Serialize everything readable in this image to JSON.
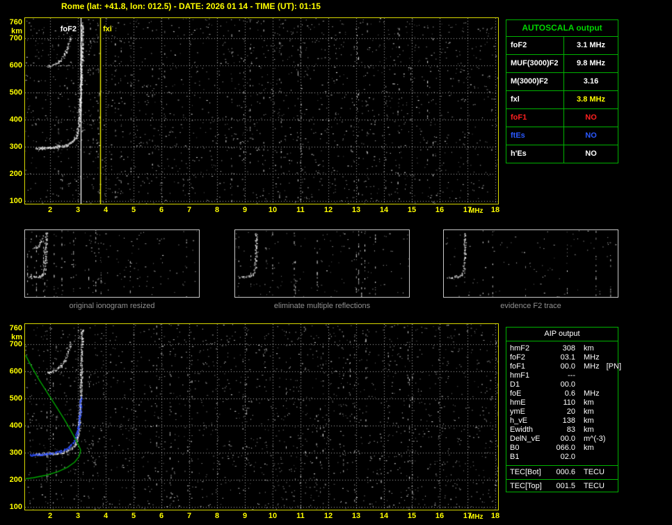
{
  "header": {
    "title": "Rome (lat: +41.8, lon: 012.5) - DATE: 2026 01 14 - TIME (UT): 01:15"
  },
  "autoscala": {
    "header": "AUTOSCALA output",
    "rows": [
      {
        "label": "foF2",
        "value": "3.1 MHz",
        "label_color": "#ffffff",
        "value_color": "#ffffff"
      },
      {
        "label": "MUF(3000)F2",
        "value": "9.8 MHz",
        "label_color": "#ffffff",
        "value_color": "#ffffff"
      },
      {
        "label": "M(3000)F2",
        "value": "3.16",
        "label_color": "#ffffff",
        "value_color": "#ffffff"
      },
      {
        "label": "fxl",
        "value": "3.8 MHz",
        "label_color": "#ffffff",
        "value_color": "#ffff00"
      },
      {
        "label": "foF1",
        "value": "NO",
        "label_color": "#ff2020",
        "value_color": "#ff2020"
      },
      {
        "label": "ftEs",
        "value": "NO",
        "label_color": "#2a58ff",
        "value_color": "#2a58ff"
      },
      {
        "label": "h'Es",
        "value": "NO",
        "label_color": "#ffffff",
        "value_color": "#ffffff"
      }
    ]
  },
  "thumbnails": [
    {
      "caption": "original ionogram resized"
    },
    {
      "caption": "eliminate multiple reflections"
    },
    {
      "caption": "evidence F2 trace"
    }
  ],
  "aip": {
    "header": "AIP output",
    "rows": [
      {
        "name": "hmF2",
        "value": "308",
        "unit": "km",
        "note": ""
      },
      {
        "name": "foF2",
        "value": "03.1",
        "unit": "MHz",
        "note": ""
      },
      {
        "name": "foF1",
        "value": "00.0",
        "unit": "MHz",
        "note": "[PN]"
      },
      {
        "name": "hmF1",
        "value": "---",
        "unit": "",
        "note": ""
      },
      {
        "name": "D1",
        "value": "00.0",
        "unit": "",
        "note": ""
      },
      {
        "name": "foE",
        "value": "0.6",
        "unit": "MHz",
        "note": ""
      },
      {
        "name": "hmE",
        "value": "110",
        "unit": "km",
        "note": ""
      },
      {
        "name": "ymE",
        "value": "20",
        "unit": "km",
        "note": ""
      },
      {
        "name": "h_vE",
        "value": "138",
        "unit": "km",
        "note": ""
      },
      {
        "name": "Ewidth",
        "value": "83",
        "unit": "km",
        "note": ""
      },
      {
        "name": "DelN_vE",
        "value": "00.0",
        "unit": "m^(-3)",
        "note": ""
      },
      {
        "name": "B0",
        "value": "066.0",
        "unit": "km",
        "note": ""
      },
      {
        "name": "B1",
        "value": "02.0",
        "unit": "",
        "note": ""
      }
    ],
    "tec_rows": [
      {
        "name": "TEC[Bot]",
        "value": "000.6",
        "unit": "TECU"
      },
      {
        "name": "TEC[Top]",
        "value": "001.5",
        "unit": "TECU"
      }
    ]
  },
  "chart_data": [
    {
      "id": "ionogram-main",
      "type": "scatter",
      "title": "",
      "xlabel": "MHz",
      "ylabel": "km",
      "xlim": [
        1.1,
        18.1
      ],
      "ylim": [
        90,
        775
      ],
      "x_ticks": [
        2,
        3,
        4,
        5,
        6,
        7,
        8,
        9,
        10,
        11,
        12,
        13,
        14,
        15,
        16,
        17,
        18
      ],
      "y_ticks": [
        760,
        700,
        600,
        500,
        400,
        300,
        200,
        100
      ],
      "x_grid": [
        2,
        3,
        4,
        5,
        6,
        7,
        8,
        9,
        10,
        11,
        12,
        13,
        14,
        15,
        16,
        17,
        18
      ],
      "y_grid": [
        100,
        200,
        300,
        400,
        500,
        600,
        700
      ],
      "grid": true,
      "markers": [
        {
          "label": "foF2",
          "freq": 3.1,
          "color": "#ffffff"
        },
        {
          "label": "fxi",
          "freq": 3.8,
          "color": "#ffff00"
        }
      ],
      "f2_trace": [
        [
          1.5,
          295
        ],
        [
          1.9,
          297
        ],
        [
          2.2,
          300
        ],
        [
          2.5,
          305
        ],
        [
          2.7,
          313
        ],
        [
          2.85,
          325
        ],
        [
          2.95,
          345
        ],
        [
          3.02,
          385
        ],
        [
          3.06,
          440
        ],
        [
          3.09,
          510
        ],
        [
          3.11,
          600
        ],
        [
          3.13,
          700
        ],
        [
          3.14,
          760
        ]
      ],
      "second_hop": [
        [
          1.9,
          598
        ],
        [
          2.1,
          603
        ],
        [
          2.3,
          613
        ],
        [
          2.45,
          630
        ],
        [
          2.55,
          650
        ],
        [
          2.65,
          678
        ],
        [
          2.72,
          712
        ]
      ]
    },
    {
      "id": "ionogram-aip",
      "type": "scatter",
      "title": "",
      "xlabel": "MHz",
      "ylabel": "km",
      "xlim": [
        1.1,
        18.1
      ],
      "ylim": [
        90,
        775
      ],
      "x_ticks": [
        2,
        3,
        4,
        5,
        6,
        7,
        8,
        9,
        10,
        11,
        12,
        13,
        14,
        15,
        16,
        17,
        18
      ],
      "y_ticks": [
        760,
        700,
        600,
        500,
        400,
        300,
        200,
        100
      ],
      "x_grid": [
        2,
        3,
        4,
        5,
        6,
        7,
        8,
        9,
        10,
        11,
        12,
        13,
        14,
        15,
        16,
        17,
        18
      ],
      "y_grid": [
        100,
        200,
        300,
        400,
        500,
        600,
        700
      ],
      "grid": true,
      "markers": [],
      "f2_trace": [
        [
          1.5,
          295
        ],
        [
          1.9,
          297
        ],
        [
          2.2,
          300
        ],
        [
          2.5,
          305
        ],
        [
          2.7,
          313
        ],
        [
          2.85,
          325
        ],
        [
          2.95,
          345
        ],
        [
          3.02,
          385
        ],
        [
          3.06,
          440
        ],
        [
          3.09,
          510
        ],
        [
          3.11,
          600
        ],
        [
          3.13,
          700
        ],
        [
          3.14,
          760
        ]
      ],
      "second_hop": [
        [
          1.9,
          598
        ],
        [
          2.1,
          603
        ],
        [
          2.3,
          613
        ],
        [
          2.45,
          630
        ],
        [
          2.55,
          650
        ],
        [
          2.65,
          678
        ],
        [
          2.72,
          712
        ]
      ],
      "fitted_trace": {
        "color": "#2e50ff",
        "points": [
          [
            1.3,
            293
          ],
          [
            1.7,
            295
          ],
          [
            2.05,
            299
          ],
          [
            2.35,
            305
          ],
          [
            2.6,
            315
          ],
          [
            2.8,
            333
          ],
          [
            2.93,
            360
          ],
          [
            3.02,
            400
          ],
          [
            3.07,
            455
          ],
          [
            3.1,
            510
          ]
        ]
      },
      "profile": {
        "color": "#00a800",
        "points": [
          [
            1.12,
            660
          ],
          [
            1.35,
            615
          ],
          [
            1.6,
            570
          ],
          [
            1.9,
            522
          ],
          [
            2.2,
            474
          ],
          [
            2.5,
            425
          ],
          [
            2.75,
            381
          ],
          [
            2.95,
            343
          ],
          [
            3.08,
            315
          ],
          [
            3.1,
            308
          ],
          [
            3.04,
            286
          ],
          [
            2.88,
            265
          ],
          [
            2.62,
            246
          ],
          [
            2.28,
            230
          ],
          [
            1.85,
            217
          ],
          [
            1.4,
            208
          ],
          [
            1.12,
            204
          ]
        ]
      }
    }
  ]
}
